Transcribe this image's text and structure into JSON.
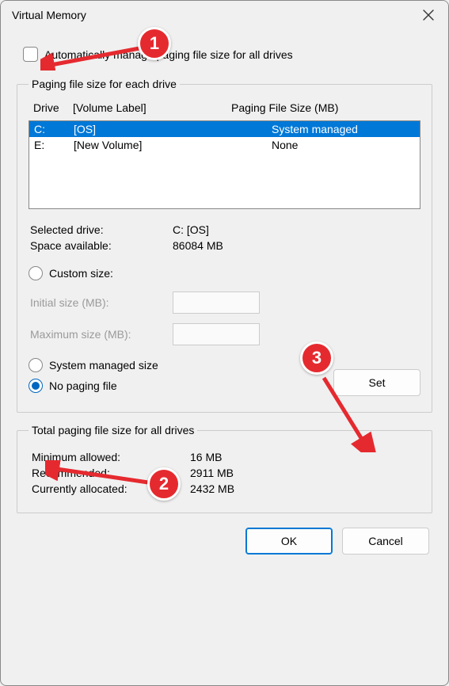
{
  "window": {
    "title": "Virtual Memory"
  },
  "auto_manage": {
    "label": "Automatically manage paging file size for all drives",
    "checked": false
  },
  "drives_group": {
    "legend": "Paging file size for each drive",
    "headers": {
      "drive": "Drive",
      "label": "[Volume Label]",
      "size": "Paging File Size (MB)"
    },
    "rows": [
      {
        "drive": "C:",
        "label": "[OS]",
        "size": "System managed",
        "selected": true
      },
      {
        "drive": "E:",
        "label": "[New Volume]",
        "size": "None",
        "selected": false
      }
    ]
  },
  "selected": {
    "drive_label": "Selected drive:",
    "drive_value": "C:  [OS]",
    "space_label": "Space available:",
    "space_value": "86084 MB"
  },
  "options": {
    "custom": {
      "label": "Custom size:",
      "checked": false
    },
    "initial_label": "Initial size (MB):",
    "maximum_label": "Maximum size (MB):",
    "system_managed": {
      "label": "System managed size",
      "checked": false
    },
    "no_paging": {
      "label": "No paging file",
      "checked": true
    },
    "set_button": "Set"
  },
  "totals": {
    "legend": "Total paging file size for all drives",
    "min_label": "Minimum allowed:",
    "min_value": "16 MB",
    "rec_label": "Recommended:",
    "rec_value": "2911 MB",
    "cur_label": "Currently allocated:",
    "cur_value": "2432 MB"
  },
  "footer": {
    "ok": "OK",
    "cancel": "Cancel"
  },
  "annotations": {
    "b1": "1",
    "b2": "2",
    "b3": "3"
  }
}
